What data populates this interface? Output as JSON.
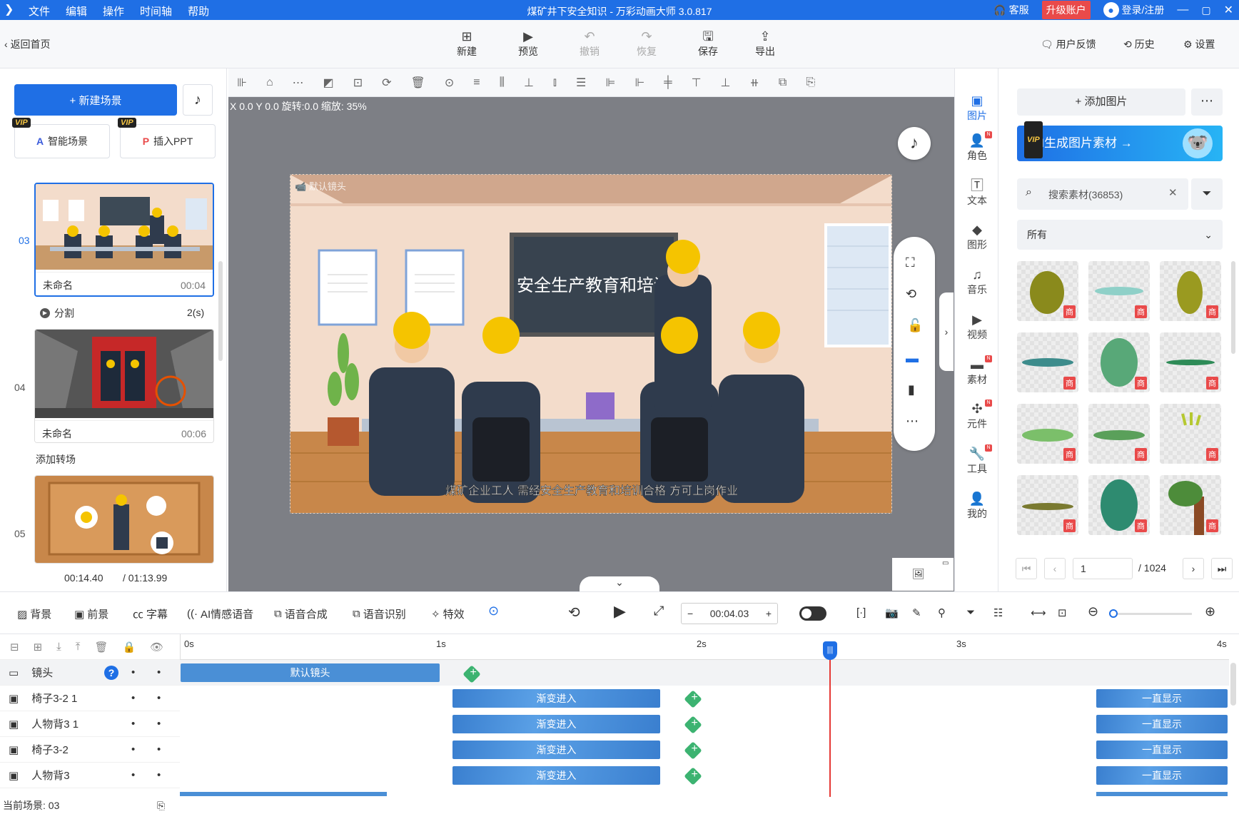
{
  "menu": [
    "文件",
    "编辑",
    "操作",
    "时间轴",
    "帮助"
  ],
  "window_title": "煤矿井下安全知识 - 万彩动画大师 3.0.817",
  "titlebar_right": {
    "service": "客服",
    "upgrade": "升级账户",
    "login": "登录/注册"
  },
  "toolbar": {
    "back": "返回首页",
    "new": "新建",
    "preview": "预览",
    "undo": "撤销",
    "redo": "恢复",
    "save": "保存",
    "export": "导出",
    "feedback": "用户反馈",
    "history": "历史",
    "settings": "设置"
  },
  "left": {
    "new_scene": "+ 新建场景",
    "smart_scene": "智能场景",
    "insert_ppt": "插入PPT",
    "vip": "VIP",
    "scenes": [
      {
        "num": "03",
        "name": "未命名",
        "time": "00:04"
      },
      {
        "num": "04",
        "name": "未命名",
        "time": "00:06"
      },
      {
        "num": "05"
      }
    ],
    "split_label": "分割",
    "split_value": "2(s)",
    "add_transition": "添加转场",
    "current_time": "00:14.40",
    "total_time": "/ 01:13.99"
  },
  "canvas": {
    "coord": "X 0.0 Y 0.0 旋转:0.0 缩放: 35%",
    "camera_label": "默认镜头",
    "board_text": "安全生产教育和培训",
    "subtitle": "煤矿企业工人 需经安全生产教育和培训合格 方可上岗作业"
  },
  "rightnav": [
    {
      "label": "图片",
      "icon": "image-icon"
    },
    {
      "label": "角色",
      "icon": "person-icon",
      "dot": "N"
    },
    {
      "label": "文本",
      "icon": "text-icon"
    },
    {
      "label": "图形",
      "icon": "shape-icon"
    },
    {
      "label": "音乐",
      "icon": "music-icon"
    },
    {
      "label": "视频",
      "icon": "video-icon"
    },
    {
      "label": "素材",
      "icon": "material-icon",
      "dot": "N"
    },
    {
      "label": "元件",
      "icon": "component-icon",
      "dot": "N"
    },
    {
      "label": "工具",
      "icon": "tool-icon",
      "dot": "N"
    },
    {
      "label": "我的",
      "icon": "user-icon"
    }
  ],
  "assets": {
    "add_image": "+ 添加图片",
    "ai_banner": "AI生成图片素材 →",
    "search_placeholder": "搜索素材(36853)",
    "filter": "所有",
    "badge": "商",
    "page_current": "1",
    "page_total": "/ 1024"
  },
  "timeline": {
    "tools": [
      "背景",
      "前景",
      "字幕",
      "AI情感语音",
      "语音合成",
      "语音识别",
      "特效"
    ],
    "time": "00:04.03",
    "ruler": [
      "0s",
      "1s",
      "2s",
      "3s",
      "4s"
    ],
    "tracks": [
      {
        "name": "镜头",
        "clip": "默认镜头"
      },
      {
        "name": "椅子3-2 1",
        "clip": "渐变进入",
        "end": "一直显示"
      },
      {
        "name": "人物背3 1",
        "clip": "渐变进入",
        "end": "一直显示"
      },
      {
        "name": "椅子3-2",
        "clip": "渐变进入",
        "end": "一直显示"
      },
      {
        "name": "人物背3",
        "clip": "渐变进入",
        "end": "一直显示"
      }
    ],
    "current_scene": "当前场景: 03"
  }
}
